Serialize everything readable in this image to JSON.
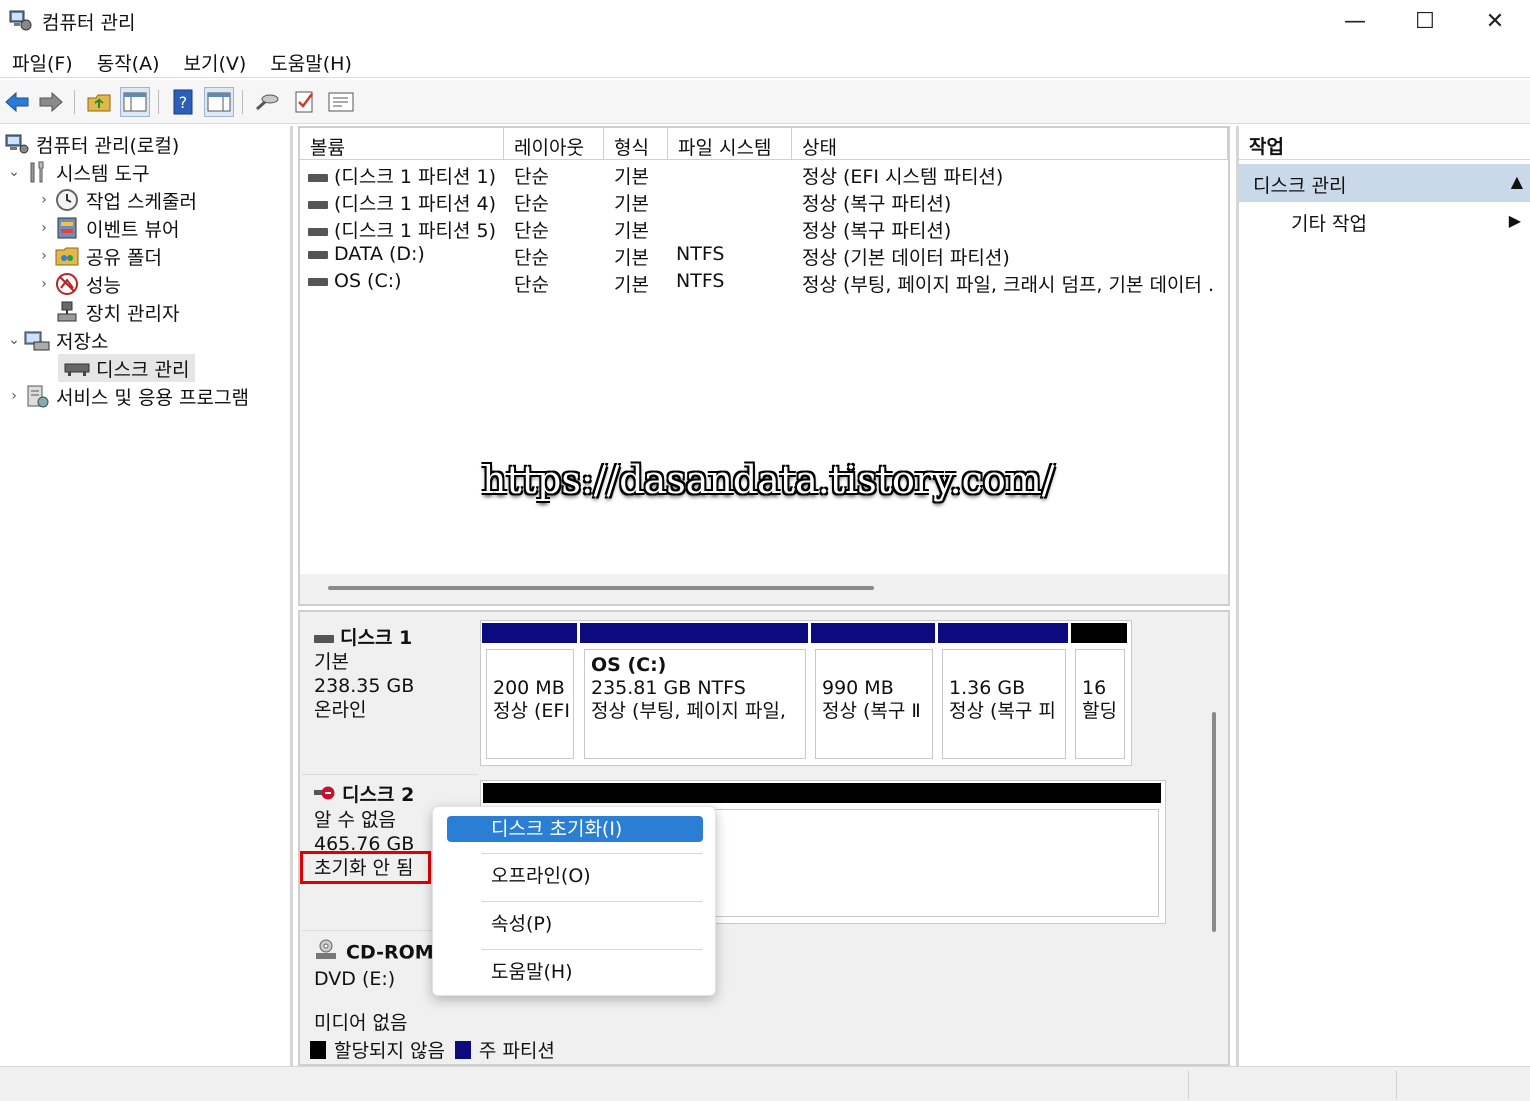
{
  "window": {
    "title": "컴퓨터 관리",
    "minimize": "—",
    "maximize": "☐",
    "close": "✕"
  },
  "menu": [
    "파일(F)",
    "동작(A)",
    "보기(V)",
    "도움말(H)"
  ],
  "tree": {
    "root": "컴퓨터 관리(로컬)",
    "system_tools": "시스템 도구",
    "task_scheduler": "작업 스케줄러",
    "event_viewer": "이벤트 뷰어",
    "shared_folders": "공유 폴더",
    "performance": "성능",
    "device_manager": "장치 관리자",
    "storage": "저장소",
    "disk_management": "디스크 관리",
    "services": "서비스 및 응용 프로그램"
  },
  "columns": [
    "볼륨",
    "레이아웃",
    "형식",
    "파일 시스템",
    "상태"
  ],
  "volumes": [
    {
      "name": "(디스크 1 파티션 1)",
      "layout": "단순",
      "type": "기본",
      "fs": "",
      "status": "정상 (EFI 시스템 파티션)"
    },
    {
      "name": "(디스크 1 파티션 4)",
      "layout": "단순",
      "type": "기본",
      "fs": "",
      "status": "정상 (복구 파티션)"
    },
    {
      "name": "(디스크 1 파티션 5)",
      "layout": "단순",
      "type": "기본",
      "fs": "",
      "status": "정상 (복구 파티션)"
    },
    {
      "name": "DATA (D:)",
      "layout": "단순",
      "type": "기본",
      "fs": "NTFS",
      "status": "정상 (기본 데이터 파티션)"
    },
    {
      "name": "OS (C:)",
      "layout": "단순",
      "type": "기본",
      "fs": "NTFS",
      "status": "정상 (부팅, 페이지 파일, 크래시 덤프, 기본 데이터 ."
    }
  ],
  "watermark": "https://dasandata.tistory.com/",
  "disk1": {
    "title": "디스크 1",
    "type": "기본",
    "size": "238.35 GB",
    "state": "온라인",
    "partitions": [
      {
        "line1": "",
        "line2": "200 MB",
        "line3": "정상 (EFI"
      },
      {
        "line1": "OS  (C:)",
        "line2": "235.81 GB NTFS",
        "line3": "정상 (부팅, 페이지 파일,"
      },
      {
        "line1": "",
        "line2": "990 MB",
        "line3": "정상 (복구 Ⅱ"
      },
      {
        "line1": "",
        "line2": "1.36 GB",
        "line3": "정상 (복구 피"
      },
      {
        "line1": "",
        "line2": "16",
        "line3": "할딩"
      }
    ]
  },
  "disk2": {
    "title": "디스크 2",
    "type": "알 수 없음",
    "size": "465.76 GB",
    "state": "초기화 안 됨"
  },
  "cdrom": {
    "title": "CD-ROM",
    "drive": "DVD (E:)",
    "state": "미디어 없음"
  },
  "legend": {
    "unallocated": "할당되지 않음",
    "primary": "주 파티션",
    "unallocated_color": "#000000",
    "primary_color": "#0b0b7f"
  },
  "context_menu": {
    "initialize": "디스크 초기화(I)",
    "offline": "오프라인(O)",
    "properties": "속성(P)",
    "help": "도움말(H)"
  },
  "actions": {
    "header": "작업",
    "section": "디스크 관리",
    "more": "기타 작업"
  }
}
